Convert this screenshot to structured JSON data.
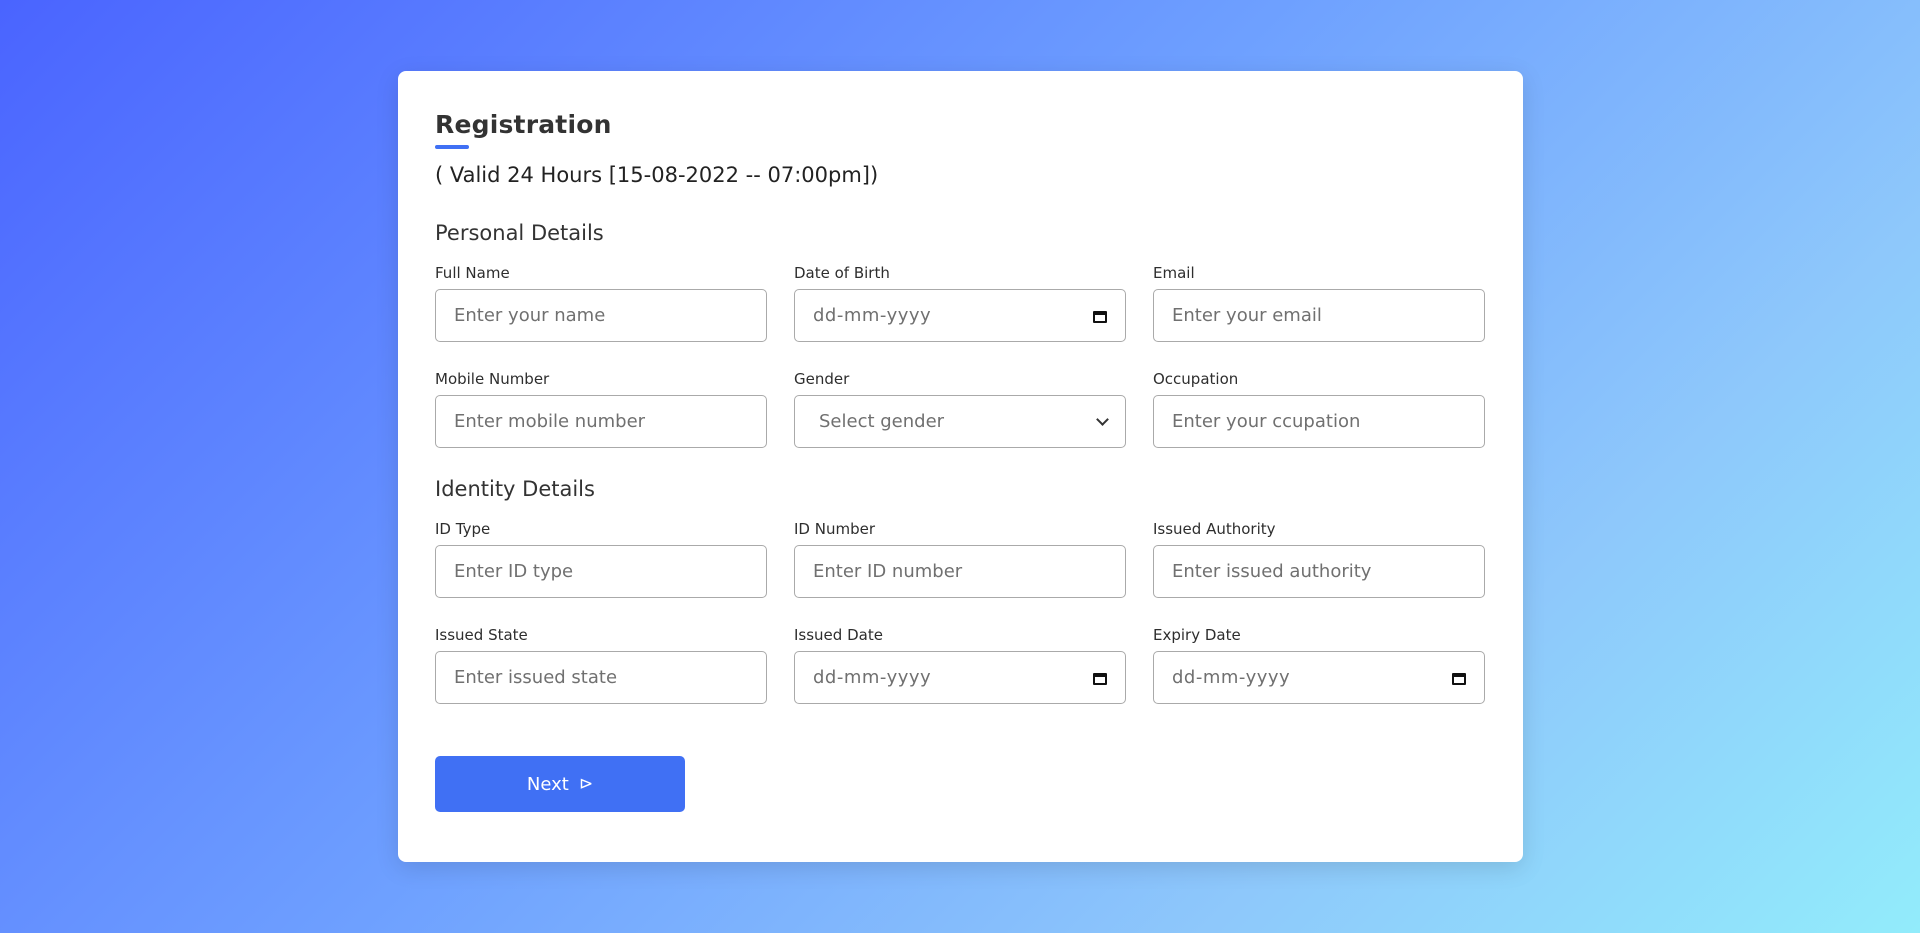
{
  "form": {
    "title": "Registration",
    "validity": "( Valid 24 Hours [15-08-2022 -- 07:00pm])",
    "personal": {
      "heading": "Personal Details",
      "full_name": {
        "label": "Full Name",
        "placeholder": "Enter your name"
      },
      "dob": {
        "label": "Date of Birth",
        "value": "dd-mm-yyyy"
      },
      "email": {
        "label": "Email",
        "placeholder": "Enter your email"
      },
      "mobile": {
        "label": "Mobile Number",
        "placeholder": "Enter mobile number"
      },
      "gender": {
        "label": "Gender",
        "selected": "Select gender"
      },
      "occupation": {
        "label": "Occupation",
        "placeholder": "Enter your ccupation"
      }
    },
    "identity": {
      "heading": "Identity Details",
      "id_type": {
        "label": "ID Type",
        "placeholder": "Enter ID type"
      },
      "id_number": {
        "label": "ID Number",
        "placeholder": "Enter ID number"
      },
      "issued_authority": {
        "label": "Issued Authority",
        "placeholder": "Enter issued authority"
      },
      "issued_state": {
        "label": "Issued State",
        "placeholder": "Enter issued state"
      },
      "issued_date": {
        "label": "Issued Date",
        "value": "dd-mm-yyyy"
      },
      "expiry_date": {
        "label": "Expiry Date",
        "value": "dd-mm-yyyy"
      }
    },
    "next_button": {
      "label": "Next",
      "icon": "send-icon"
    }
  },
  "colors": {
    "accent": "#4070f4",
    "gradient_start": "#4a64ff",
    "gradient_end": "#92ecfb"
  }
}
